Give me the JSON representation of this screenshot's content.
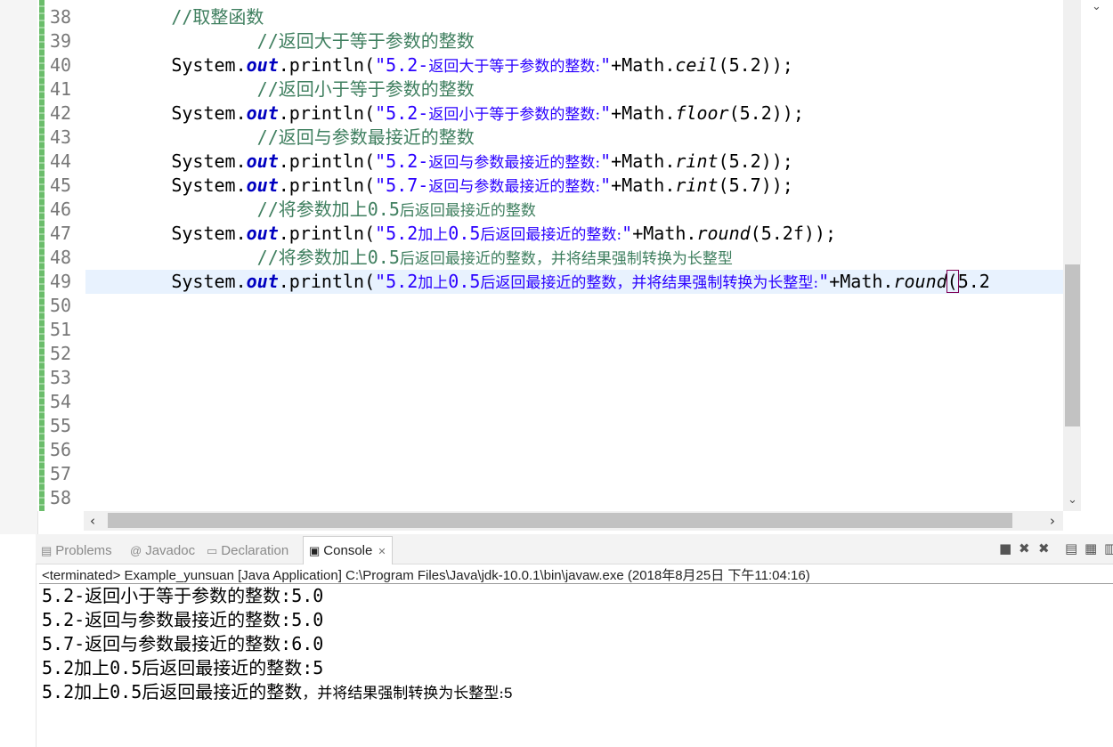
{
  "editor": {
    "line_numbers": [
      "38",
      "39",
      "40",
      "41",
      "42",
      "43",
      "44",
      "45",
      "46",
      "47",
      "48",
      "49",
      "50",
      "51",
      "52",
      "53",
      "54",
      "55",
      "56",
      "57",
      "58"
    ],
    "current_line": "49"
  },
  "code": {
    "l38": {
      "comment": "//取整函数"
    },
    "l39": {
      "comment": "//返回大于等于参数的整数"
    },
    "l40": {
      "sys": "System.",
      "out": "out",
      "println": ".println(",
      "str_a": "\"5.2-",
      "str_b": "返回大于等于参数的整数:",
      "str_c": "\"",
      "plus": "+Math.",
      "method": "ceil",
      "args": "(5.2));"
    },
    "l41": {
      "comment": "//返回小于等于参数的整数"
    },
    "l42": {
      "sys": "System.",
      "out": "out",
      "println": ".println(",
      "str_a": "\"5.2-",
      "str_b": "返回小于等于参数的整数:",
      "str_c": "\"",
      "plus": "+Math.",
      "method": "floor",
      "args": "(5.2));"
    },
    "l43": {
      "comment": "//返回与参数最接近的整数"
    },
    "l44": {
      "sys": "System.",
      "out": "out",
      "println": ".println(",
      "str_a": "\"5.2-",
      "str_b": "返回与参数最接近的整数:",
      "str_c": "\"",
      "plus": "+Math.",
      "method": "rint",
      "args": "(5.2));"
    },
    "l45": {
      "sys": "System.",
      "out": "out",
      "println": ".println(",
      "str_a": "\"5.7-",
      "str_b": "返回与参数最接近的整数:",
      "str_c": "\"",
      "plus": "+Math.",
      "method": "rint",
      "args": "(5.7));"
    },
    "l46": {
      "comment_a": "//将参数加上0.5",
      "comment_b": "后返回最接近的整数"
    },
    "l47": {
      "sys": "System.",
      "out": "out",
      "println": ".println(",
      "str_a": "\"5.2",
      "str_b1": "加上",
      "str_mid": "0.5",
      "str_b2": "后返回最接近的整数:",
      "str_c": "\"",
      "plus": "+Math.",
      "method": "round",
      "args": "(5.2f));"
    },
    "l48": {
      "comment_a": "//将参数加上0.5",
      "comment_b": "后返回最接近的整数，并将结果强制转换为长整型"
    },
    "l49": {
      "sys": "System.",
      "out": "out",
      "println": ".println(",
      "str_a": "\"5.2",
      "str_b1": "加上",
      "str_mid": "0.5",
      "str_b2": "后返回最接近的整数，并将结果强制转换为长整型:",
      "str_c": "\"",
      "plus": "+Math.",
      "method": "round",
      "paren": "(",
      "args": "5.2"
    }
  },
  "tabs": {
    "problems": "Problems",
    "javadoc": "Javadoc",
    "declaration": "Declaration",
    "console": "Console"
  },
  "console": {
    "terminated": "<terminated> Example_yunsuan [Java Application] C:\\Program Files\\Java\\jdk-10.0.1\\bin\\javaw.exe (2018年8月25日 下午11:04:16)",
    "out1": "5.2-返回小于等于参数的整数:5.0",
    "out2": "5.2-返回与参数最接近的整数:5.0",
    "out3": "5.7-返回与参数最接近的整数:6.0",
    "out4": "5.2加上0.5后返回最接近的整数:5",
    "out5_a": "5.2加上0.5后返回最接近的整数",
    "out5_b": "，并将结果强制转换为长整型:",
    "out5_c": "5"
  },
  "colors": {
    "comment": "#3f7f5f",
    "string": "#2a00ff",
    "field": "#0000c0",
    "current_line": "#e8f2fe"
  }
}
